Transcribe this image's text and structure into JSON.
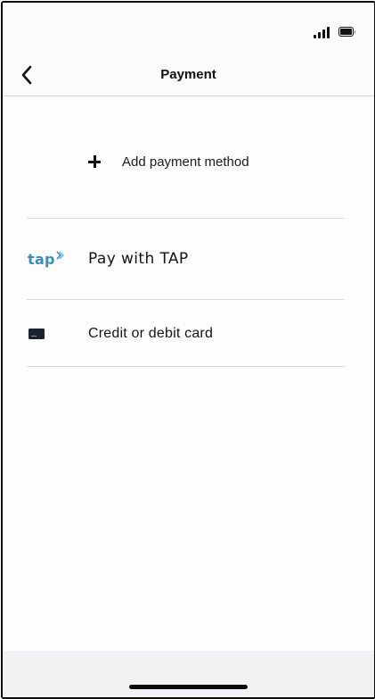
{
  "status_bar": {
    "signal_icon": "signal-bars-icon",
    "battery_icon": "battery-icon",
    "battery_level": 1.0
  },
  "nav": {
    "back_icon": "chevron-left-icon",
    "title": "Payment"
  },
  "add_payment": {
    "icon": "plus-icon",
    "label": "Add payment method"
  },
  "methods": [
    {
      "icon": "tap-logo-icon",
      "logo_text": "tap",
      "label": "Pay with TAP",
      "brand_color": "#3a8fb8"
    },
    {
      "icon": "credit-card-icon",
      "label": "Credit or debit card"
    }
  ],
  "colors": {
    "background": "#fbfbfc",
    "divider": "#dcdcdf",
    "text": "#141414",
    "bottom_bar": "#f2f2f4"
  }
}
